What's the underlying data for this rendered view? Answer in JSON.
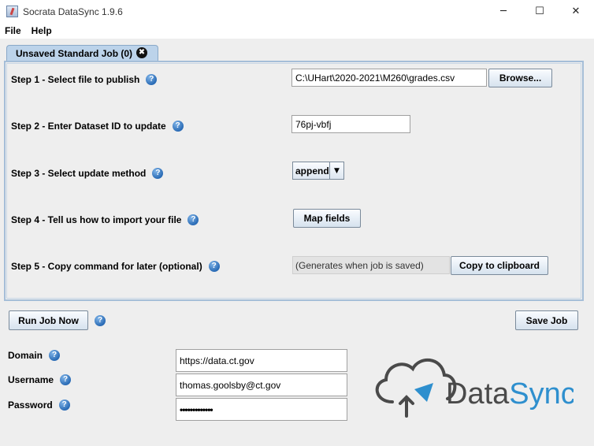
{
  "window": {
    "title": "Socrata DataSync 1.9.6",
    "minimize_glyph": "─",
    "maximize_glyph": "☐",
    "close_glyph": "✕"
  },
  "menu": {
    "file": "File",
    "help": "Help"
  },
  "tab": {
    "label": "Unsaved Standard Job (0)",
    "close_glyph": "✖"
  },
  "help_glyph": "?",
  "steps": {
    "step1": {
      "label": "Step 1 - Select file to publish",
      "file_path": "C:\\UHart\\2020-2021\\M260\\grades.csv",
      "browse_label": "Browse..."
    },
    "step2": {
      "label": "Step 2 - Enter Dataset ID to update",
      "dataset_id": "76pj-vbfj"
    },
    "step3": {
      "label": "Step 3 - Select update method",
      "method": "append",
      "arrow": "▼"
    },
    "step4": {
      "label": "Step 4 - Tell us how to import your file",
      "map_fields_label": "Map fields"
    },
    "step5": {
      "label": "Step 5 - Copy command for later (optional)",
      "generated_text": "(Generates when job is saved)",
      "copy_label": "Copy to clipboard"
    }
  },
  "actions": {
    "run_label": "Run Job Now",
    "save_label": "Save Job"
  },
  "credentials": {
    "domain_label": "Domain",
    "domain_value": "https://data.ct.gov",
    "username_label": "Username",
    "username_value": "thomas.goolsby@ct.gov",
    "password_label": "Password",
    "password_value": "•••••••••••••"
  },
  "logo": {
    "text_a": "Data",
    "text_b": "Sync",
    "color_dark": "#4a4a4a",
    "color_blue": "#2e8fce"
  }
}
